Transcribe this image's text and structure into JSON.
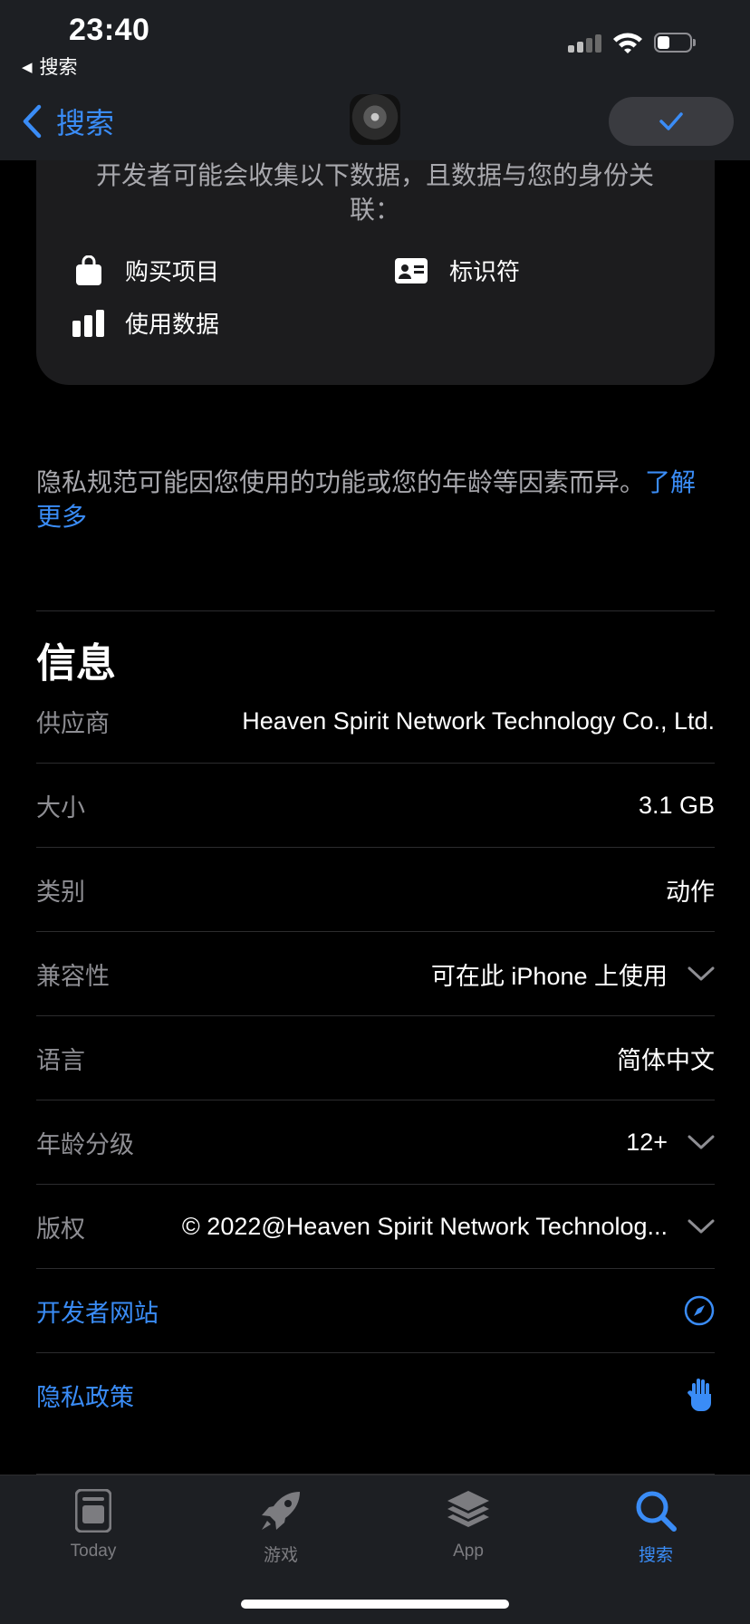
{
  "status_bar": {
    "time": "23:40",
    "back_app": "搜索"
  },
  "nav": {
    "back_label": "搜索",
    "done_icon": "checkmark-icon"
  },
  "privacy": {
    "intro": "开发者可能会收集以下数据，且数据与您的身份关联：",
    "items": [
      {
        "icon": "shopping-bag-icon",
        "label": "购买项目"
      },
      {
        "icon": "id-card-icon",
        "label": "标识符"
      },
      {
        "icon": "bar-chart-icon",
        "label": "使用数据"
      }
    ],
    "note": "隐私规范可能因您使用的功能或您的年龄等因素而异。",
    "learn_more": "了解更多"
  },
  "info": {
    "title": "信息",
    "rows": [
      {
        "label": "供应商",
        "value": "Heaven Spirit Network Technology  Co., Ltd."
      },
      {
        "label": "大小",
        "value": "3.1 GB"
      },
      {
        "label": "类别",
        "value": "动作"
      },
      {
        "label": "兼容性",
        "value": "可在此 iPhone 上使用",
        "expandable": true
      },
      {
        "label": "语言",
        "value": "简体中文"
      },
      {
        "label": "年龄分级",
        "value": "12+",
        "expandable": true
      },
      {
        "label": "版权",
        "value": "© 2022@Heaven Spirit Network Technolog...",
        "expandable": true
      }
    ],
    "links": [
      {
        "label": "开发者网站",
        "icon": "compass-icon"
      },
      {
        "label": "隐私政策",
        "icon": "hand-icon"
      }
    ]
  },
  "tabbar": {
    "tabs": [
      {
        "label": "Today",
        "icon": "today-icon",
        "active": false
      },
      {
        "label": "游戏",
        "icon": "rocket-icon",
        "active": false
      },
      {
        "label": "App",
        "icon": "layers-icon",
        "active": false
      },
      {
        "label": "搜索",
        "icon": "search-icon",
        "active": true
      }
    ]
  },
  "colors": {
    "accent": "#3a8cf6",
    "background": "#000000",
    "card": "#1c1c1e",
    "secondary_text": "#8e8e93"
  }
}
